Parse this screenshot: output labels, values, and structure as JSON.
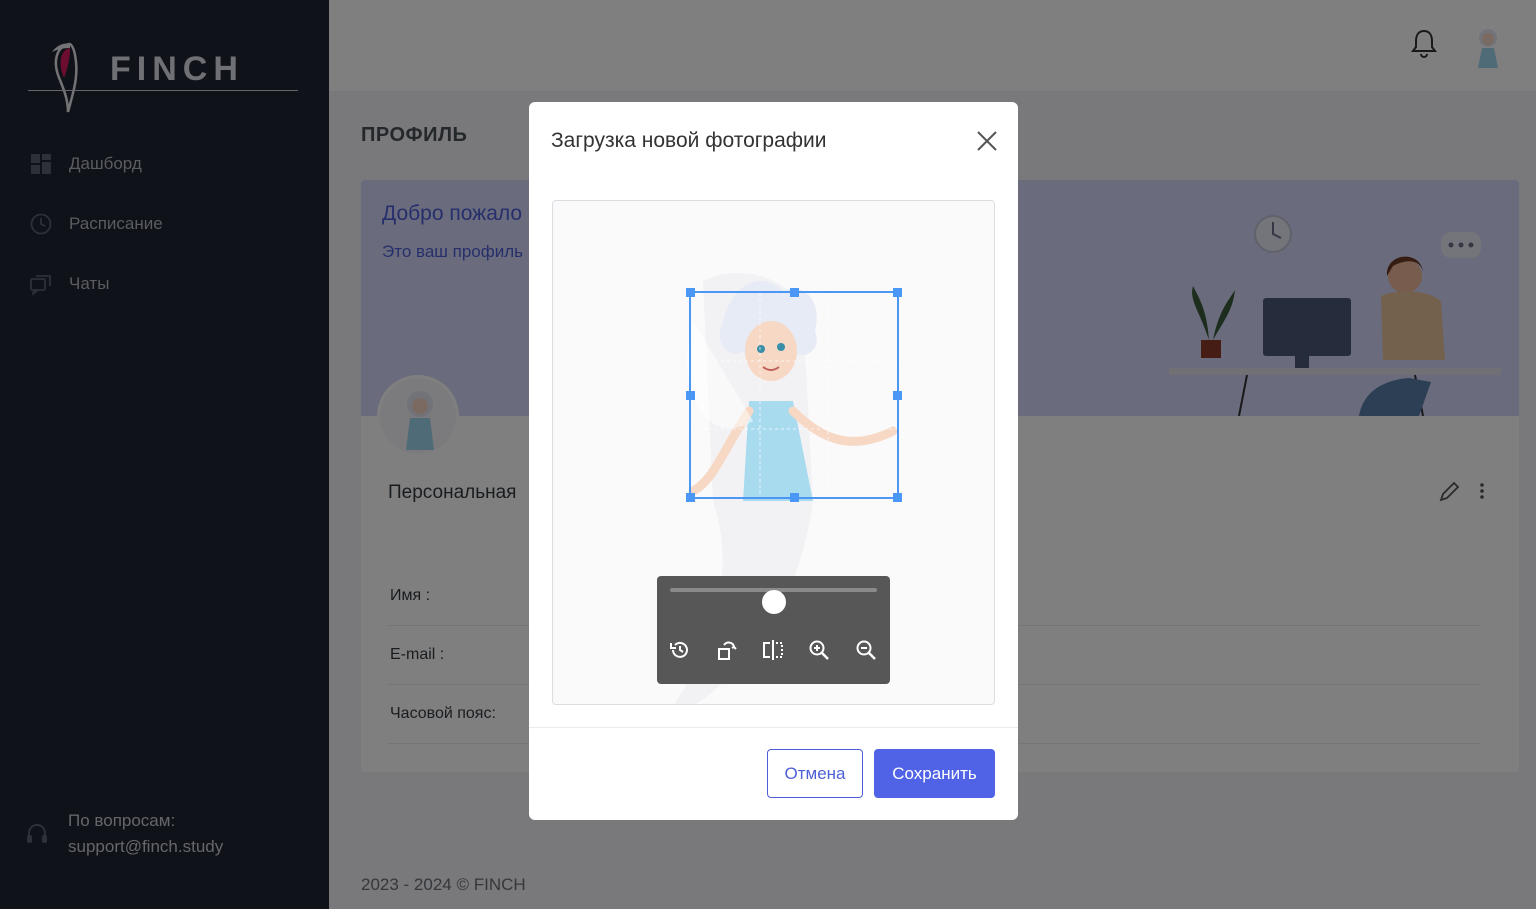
{
  "app": {
    "logo_text": "FINCH"
  },
  "sidebar": {
    "items": [
      {
        "label": "Дашборд",
        "icon": "dashboard-icon"
      },
      {
        "label": "Расписание",
        "icon": "clock-icon"
      },
      {
        "label": "Чаты",
        "icon": "chat-icon"
      }
    ],
    "support_label": "По вопросам:",
    "support_email": "support@finch.study"
  },
  "header": {
    "notifications_icon": "bell-icon",
    "avatar_icon": "user-avatar"
  },
  "page": {
    "title": "ПРОФИЛЬ"
  },
  "profile_card": {
    "welcome": "Добро пожало",
    "subtitle": "Это ваш профиль",
    "section_title": "Персональная",
    "fields": [
      {
        "label": "Имя :"
      },
      {
        "label": "E-mail :"
      },
      {
        "label": "Часовой пояс:"
      }
    ]
  },
  "footer": {
    "text": "2023 - 2024 © FINCH"
  },
  "modal": {
    "title": "Загрузка новой фотографии",
    "zoom_level": 0.5,
    "tools": [
      "reset-icon",
      "rotate-icon",
      "flip-icon",
      "zoom-in-icon",
      "zoom-out-icon"
    ],
    "cancel_label": "Отмена",
    "save_label": "Сохранить"
  },
  "colors": {
    "sidebar": "#212532",
    "accent": "#5063e6",
    "crop": "#4a97f5"
  }
}
